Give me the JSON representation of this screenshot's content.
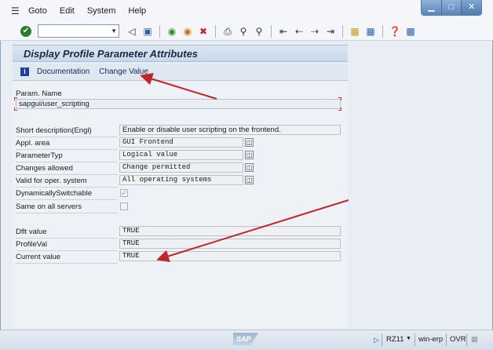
{
  "menubar": {
    "items": [
      "Goto",
      "Edit",
      "System",
      "Help"
    ],
    "icon": "menu-list-icon"
  },
  "window_controls": {
    "minimize": "▁",
    "maximize": "□",
    "close": "✕"
  },
  "toolbar": {
    "command_field_value": "",
    "icons": [
      "enter-check-icon",
      "dropdown-icon",
      "back-icon",
      "save-icon",
      "back-nav-icon",
      "exit-icon",
      "cancel-icon",
      "print-icon",
      "find-icon",
      "find-next-icon",
      "first-page-icon",
      "prev-page-icon",
      "next-page-icon",
      "last-page-icon",
      "new-session-icon",
      "shortcut-icon",
      "help-icon",
      "layout-icon"
    ]
  },
  "screen": {
    "title": "Display Profile Parameter Attributes",
    "app_toolbar": {
      "documentation_label": "Documentation",
      "change_value_label": "Change Value"
    }
  },
  "form": {
    "param_name_label": "Param. Name",
    "param_name_value": "sapgui/user_scripting",
    "rows": [
      {
        "label": "Short description(Engl)",
        "value": "Enable or disable user scripting on the frontend."
      },
      {
        "label": "Appl. area",
        "value": "GUI Frontend"
      },
      {
        "label": "ParameterTyp",
        "value": "Logical value"
      },
      {
        "label": "Changes allowed",
        "value": "Change permitted"
      },
      {
        "label": "Valid for oper. system",
        "value": "All operating systems"
      }
    ],
    "dynamically_switchable_label": "DynamicallySwitchable",
    "dynamically_switchable_checked": true,
    "same_on_all_servers_label": "Same on all servers",
    "same_on_all_servers_checked": false,
    "values": [
      {
        "label": "Dflt value",
        "value": "TRUE"
      },
      {
        "label": "ProfileVal",
        "value": "TRUE"
      },
      {
        "label": "Current value",
        "value": "TRUE"
      }
    ]
  },
  "statusbar": {
    "logo": "SAP",
    "transaction": "RZ11",
    "system": "win-erp",
    "mode": "OVR"
  },
  "colors": {
    "accent": "#2d5fa8",
    "annotation_arrow": "#c0262a"
  }
}
